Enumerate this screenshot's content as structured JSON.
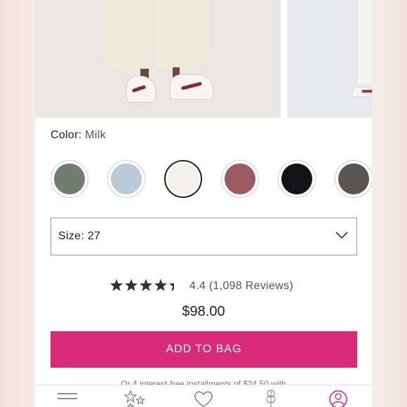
{
  "product": {
    "color_label": "Color:",
    "color_value": "Milk",
    "swatches": [
      {
        "name": "sage-green",
        "color": "#6f7d6f",
        "selected": false
      },
      {
        "name": "light-denim",
        "color": "#b9cad6",
        "selected": false
      },
      {
        "name": "milk",
        "color": "#f2f0eb",
        "selected": true
      },
      {
        "name": "mauve",
        "color": "#9b5a60",
        "selected": false
      },
      {
        "name": "black",
        "color": "#141418",
        "selected": false
      },
      {
        "name": "charcoal",
        "color": "#5a5452",
        "selected": false
      }
    ],
    "size_label": "Size: 27",
    "rating": 4.4,
    "rating_text": "4.4 (1,098 Reviews)",
    "price": "$98.00",
    "add_to_bag_label": "ADD TO BAG",
    "installment_text": "Or 4 interest-free installments of $24.50 with"
  },
  "tabbar": {
    "items": [
      {
        "name": "menu-icon"
      },
      {
        "name": "stars-icon"
      },
      {
        "name": "heart-icon"
      },
      {
        "name": "lavender-icon"
      },
      {
        "name": "account-icon"
      }
    ]
  },
  "colors": {
    "accent": "#d92a78",
    "star": "#333333"
  }
}
